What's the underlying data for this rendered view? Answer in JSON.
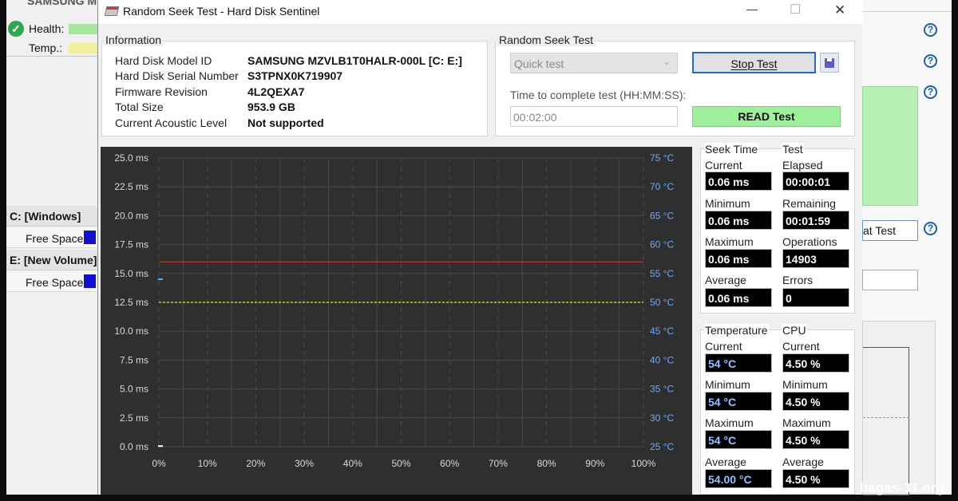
{
  "background_app": {
    "disk_name": "SAMSUNG M",
    "health_label": "Health:",
    "temp_label": "Temp.:",
    "volumes": [
      {
        "name": "C: [Windows]",
        "free_label": "Free Space"
      },
      {
        "name": "E: [New Volume]",
        "free_label": "Free Space"
      }
    ],
    "partial_button": "at Test",
    "help_glyph": "?"
  },
  "dialog": {
    "title": "Random Seek Test - Hard Disk Sentinel",
    "minimize_glyph": "—",
    "maximize_glyph": "☐",
    "close_glyph": "✕"
  },
  "information": {
    "title": "Information",
    "rows": [
      {
        "key": "Hard Disk Model ID",
        "value": "SAMSUNG MZVLB1T0HALR-000L [C: E:]"
      },
      {
        "key": "Hard Disk Serial Number",
        "value": "S3TPNX0K719907"
      },
      {
        "key": "Firmware Revision",
        "value": "4L2QEXA7"
      },
      {
        "key": "Total Size",
        "value": "953.9 GB"
      },
      {
        "key": "Current Acoustic Level",
        "value": "Not supported"
      }
    ]
  },
  "random_seek": {
    "title": "Random Seek Test",
    "mode_selected": "Quick test",
    "stop_button": "Stop Test",
    "time_label": "Time to complete test (HH:MM:SS):",
    "time_value": "00:02:00",
    "read_button": "READ Test"
  },
  "stats": {
    "seek_time": {
      "title": "Seek Time",
      "current_label": "Current",
      "current": "0.06 ms",
      "minimum_label": "Minimum",
      "minimum": "0.06 ms",
      "maximum_label": "Maximum",
      "maximum": "0.06 ms",
      "average_label": "Average",
      "average": "0.06 ms"
    },
    "test": {
      "title": "Test",
      "elapsed_label": "Elapsed",
      "elapsed": "00:00:01",
      "remaining_label": "Remaining",
      "remaining": "00:01:59",
      "operations_label": "Operations",
      "operations": "14903",
      "errors_label": "Errors",
      "errors": "0"
    },
    "temperature": {
      "title": "Temperature",
      "current_label": "Current",
      "current": "54 °C",
      "minimum_label": "Minimum",
      "minimum": "54 °C",
      "maximum_label": "Maximum",
      "maximum": "54 °C",
      "average_label": "Average",
      "average": "54.00 °C"
    },
    "cpu": {
      "title": "CPU",
      "current_label": "Current",
      "current": "4.50 %",
      "minimum_label": "Minimum",
      "minimum": "4.50 %",
      "maximum_label": "Maximum",
      "maximum": "4.50 %",
      "average_label": "Average",
      "average": "4.50 %"
    }
  },
  "chart_data": {
    "type": "line",
    "x_ticks": [
      "0%",
      "10%",
      "20%",
      "30%",
      "40%",
      "50%",
      "60%",
      "70%",
      "80%",
      "90%",
      "100%"
    ],
    "y_left_ticks": [
      "25.0 ms",
      "22.5 ms",
      "20.0 ms",
      "17.5 ms",
      "15.0 ms",
      "12.5 ms",
      "10.0 ms",
      "7.5 ms",
      "5.0 ms",
      "2.5 ms",
      "0.0 ms"
    ],
    "y_right_ticks": [
      "75 °C",
      "70 °C",
      "65 °C",
      "60 °C",
      "55 °C",
      "50 °C",
      "45 °C",
      "40 °C",
      "35 °C",
      "30 °C",
      "25 °C"
    ],
    "ylim_left": [
      0,
      25
    ],
    "ylim_right": [
      25,
      75
    ],
    "xlim": [
      0,
      100
    ],
    "red_line_ms": 16.0,
    "yellow_line_ms": 12.5,
    "blue_marker_ms": 14.5,
    "white_marker_ms": 0.06,
    "colors": {
      "background": "#2f2f2f",
      "grid": "#4a4a4a",
      "red": "#c0392b",
      "yellow": "#e8e23a",
      "blue": "#5fa8ff",
      "tick_left": "#d8d8d8",
      "tick_right": "#6fa8ff"
    }
  },
  "watermark": "bagas-31.org"
}
